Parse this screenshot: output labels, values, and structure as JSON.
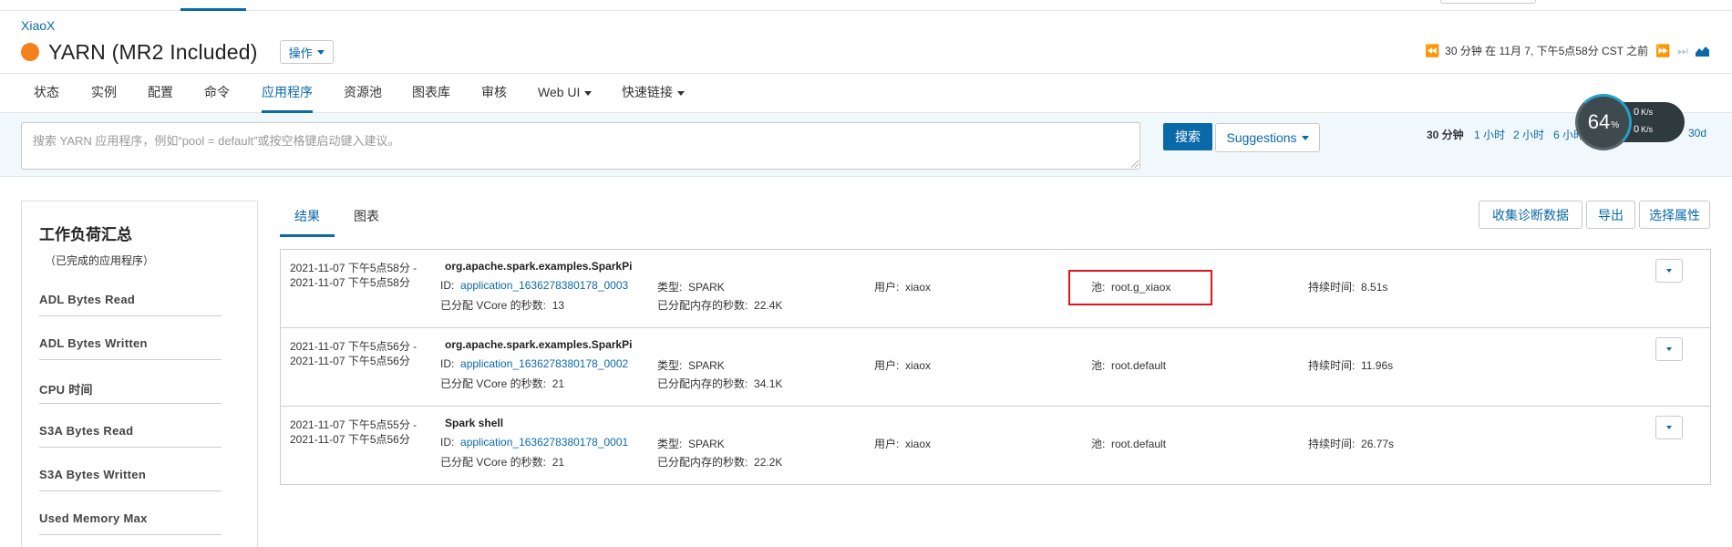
{
  "header": {
    "cluster": "XiaoX",
    "service_title": "YARN (MR2 Included)",
    "status_color": "#f5801e",
    "ops_label": "操作",
    "time_label": "30 分钟 在 11月 7, 下午5点58分 CST 之前"
  },
  "nav": {
    "tabs": [
      "状态",
      "实例",
      "配置",
      "命令",
      "应用程序",
      "资源池",
      "图表库",
      "审核",
      "Web UI",
      "快速链接"
    ],
    "active_tab": "应用程序"
  },
  "search": {
    "placeholder": "搜索 YARN 应用程序，例如“pool = default”或按空格键启动键入建议。",
    "button_label": "搜索",
    "suggestions_label": "Suggestions",
    "ranges": [
      "30 分钟",
      "1 小时",
      "2 小时",
      "6 小时",
      "30d"
    ],
    "selected_range": "30 分钟"
  },
  "gauge": {
    "percent": "64",
    "percent_sign": "%",
    "up_value": "0",
    "up_unit": "K/s",
    "down_value": "0",
    "down_unit": "K/s"
  },
  "sidebar": {
    "title": "工作负荷汇总",
    "subtitle": "（已完成的应用程序）",
    "items": [
      "ADL Bytes Read",
      "ADL Bytes Written",
      "CPU 时间",
      "S3A Bytes Read",
      "S3A Bytes Written",
      "Used Memory Max"
    ]
  },
  "results_tabs": [
    "结果",
    "图表"
  ],
  "actions": {
    "collect": "收集诊断数据",
    "export": "导出",
    "select_attrs": "选择属性"
  },
  "labels": {
    "id": "ID:",
    "type": "类型:",
    "user": "用户:",
    "pool": "池:",
    "duration": "持续时间:",
    "vcore": "已分配 VCore 的秒数:",
    "memory": "已分配内存的秒数:"
  },
  "apps": [
    {
      "start": "2021-11-07 下午5点58分 -",
      "end": "2021-11-07 下午5点58分",
      "name": "org.apache.spark.examples.SparkPi",
      "id": "application_1636278380178_0003",
      "vcore_seconds": "13",
      "type": "SPARK",
      "memory_seconds": "22.4K",
      "user": "xiaox",
      "pool": "root.g_xiaox",
      "duration": "8.51s"
    },
    {
      "start": "2021-11-07 下午5点56分 -",
      "end": "2021-11-07 下午5点56分",
      "name": "org.apache.spark.examples.SparkPi",
      "id": "application_1636278380178_0002",
      "vcore_seconds": "21",
      "type": "SPARK",
      "memory_seconds": "34.1K",
      "user": "xiaox",
      "pool": "root.default",
      "duration": "11.96s"
    },
    {
      "start": "2021-11-07 下午5点55分 -",
      "end": "2021-11-07 下午5点56分",
      "name": "Spark shell",
      "id": "application_1636278380178_0001",
      "vcore_seconds": "21",
      "type": "SPARK",
      "memory_seconds": "22.2K",
      "user": "xiaox",
      "pool": "root.default",
      "duration": "26.77s"
    }
  ],
  "colors": {
    "accent": "#0a69a8",
    "highlight": "#e0161b"
  }
}
